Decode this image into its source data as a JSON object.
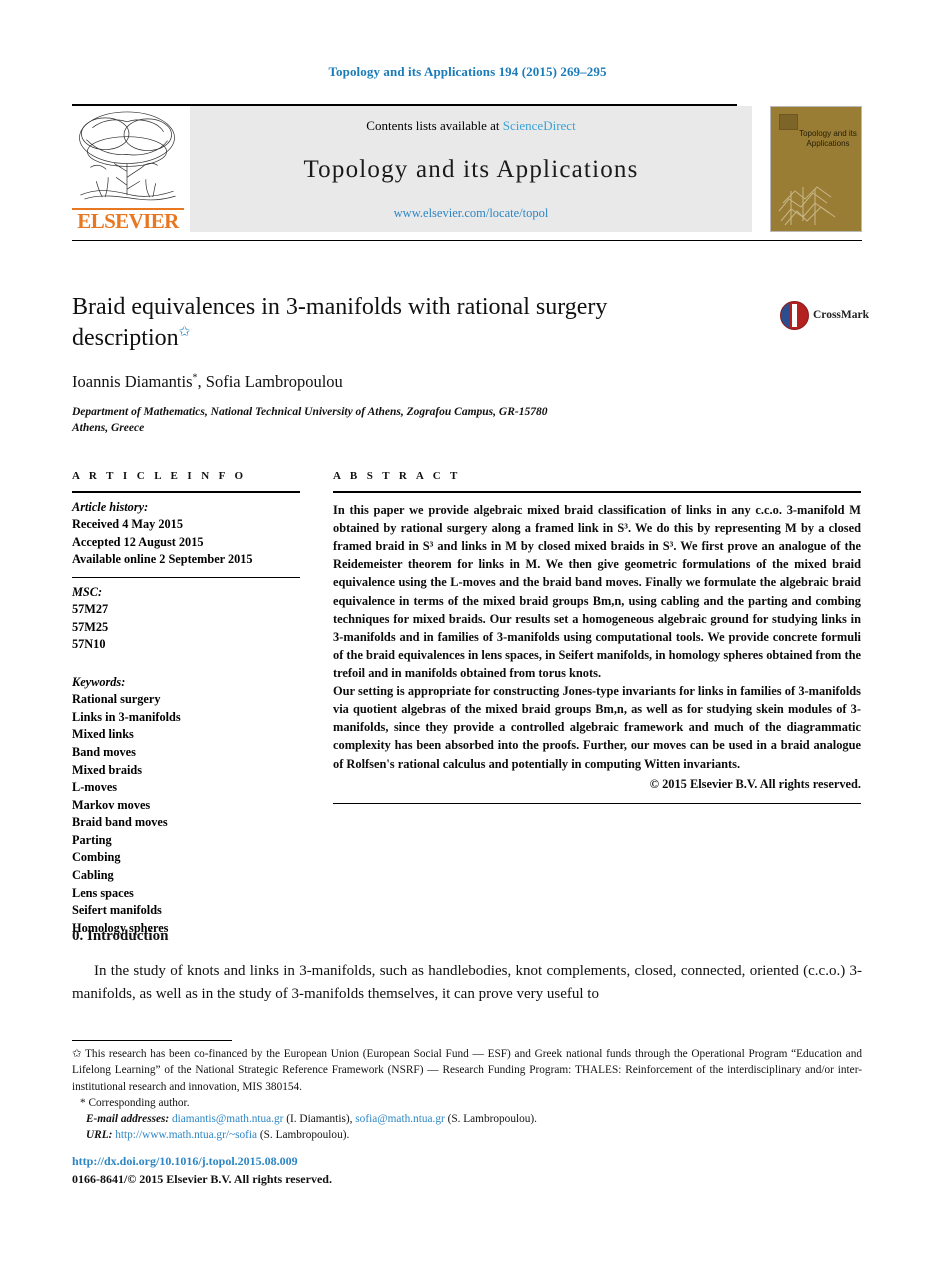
{
  "running_head": "Topology and its Applications 194 (2015) 269–295",
  "banner": {
    "contents_prefix": "Contents lists available at ",
    "sciencedirect": "ScienceDirect",
    "journal_name": "Topology and its Applications",
    "journal_url": "www.elsevier.com/locate/topol",
    "publisher": "ELSEVIER",
    "cover_title": "Topology and its Applications",
    "cover_color": "#9a7d35",
    "link_color": "#2d86c4"
  },
  "article": {
    "title": "Braid equivalences in 3-manifolds with rational surgery description",
    "title_footnote_marker": "✩",
    "authors": "Ioannis Diamantis",
    "authors_marker": "*",
    "authors_second": ", Sofia Lambropoulou",
    "affiliation_line1": "Department of Mathematics, National Technical University of Athens, Zografou Campus, GR-15780",
    "affiliation_line2": "Athens, Greece",
    "crossmark_label": "CrossMark"
  },
  "info": {
    "heading": "A R T I C L E   I N F O",
    "history_label": "Article history:",
    "history": [
      "Received 4 May 2015",
      "Accepted 12 August 2015",
      "Available online 2 September 2015"
    ],
    "msc_label": "MSC:",
    "msc": [
      "57M27",
      "57M25",
      "57N10"
    ],
    "keywords_label": "Keywords:",
    "keywords": [
      "Rational surgery",
      "Links in 3-manifolds",
      "Mixed links",
      "Band moves",
      "Mixed braids",
      "L-moves",
      "Markov moves",
      "Braid band moves",
      "Parting",
      "Combing",
      "Cabling",
      "Lens spaces",
      "Seifert manifolds",
      "Homology spheres"
    ]
  },
  "abstract": {
    "heading": "A B S T R A C T",
    "paragraph1": "In this paper we provide algebraic mixed braid classification of links in any c.c.o. 3-manifold M obtained by rational surgery along a framed link in S³. We do this by representing M by a closed framed braid in S³ and links in M by closed mixed braids in S³. We first prove an analogue of the Reidemeister theorem for links in M. We then give geometric formulations of the mixed braid equivalence using the L-moves and the braid band moves. Finally we formulate the algebraic braid equivalence in terms of the mixed braid groups Bm,n, using cabling and the parting and combing techniques for mixed braids. Our results set a homogeneous algebraic ground for studying links in 3-manifolds and in families of 3-manifolds using computational tools. We provide concrete formuli of the braid equivalences in lens spaces, in Seifert manifolds, in homology spheres obtained from the trefoil and in manifolds obtained from torus knots.",
    "paragraph2": "Our setting is appropriate for constructing Jones-type invariants for links in families of 3-manifolds via quotient algebras of the mixed braid groups Bm,n, as well as for studying skein modules of 3-manifolds, since they provide a controlled algebraic framework and much of the diagrammatic complexity has been absorbed into the proofs. Further, our moves can be used in a braid analogue of Rolfsen's rational calculus and potentially in computing Witten invariants.",
    "copyright": "© 2015 Elsevier B.V. All rights reserved."
  },
  "introduction": {
    "heading": "0. Introduction",
    "paragraph": "In the study of knots and links in 3-manifolds, such as handlebodies, knot complements, closed, connected, oriented (c.c.o.) 3-manifolds, as well as in the study of 3-manifolds themselves, it can prove very useful to"
  },
  "footnotes": {
    "funding_marker": "✩",
    "funding": "This research has been co-financed by the European Union (European Social Fund — ESF) and Greek national funds through the Operational Program “Education and Lifelong Learning” of the National Strategic Reference Framework (NSRF) — Research Funding Program: THALES: Reinforcement of the interdisciplinary and/or inter-institutional research and innovation, MIS 380154.",
    "corresponding_marker": "*",
    "corresponding": "Corresponding author.",
    "email_label": "E-mail addresses:",
    "email1": "diamantis@math.ntua.gr",
    "email1_owner": "(I. Diamantis),",
    "email2": "sofia@math.ntua.gr",
    "email2_owner": "(S. Lambropoulou).",
    "url_label": "URL:",
    "url": "http://www.math.ntua.gr/~sofia",
    "url_owner": "(S. Lambropoulou)."
  },
  "footer": {
    "doi": "http://dx.doi.org/10.1016/j.topol.2015.08.009",
    "issn_copyright": "0166-8641/© 2015 Elsevier B.V. All rights reserved."
  }
}
